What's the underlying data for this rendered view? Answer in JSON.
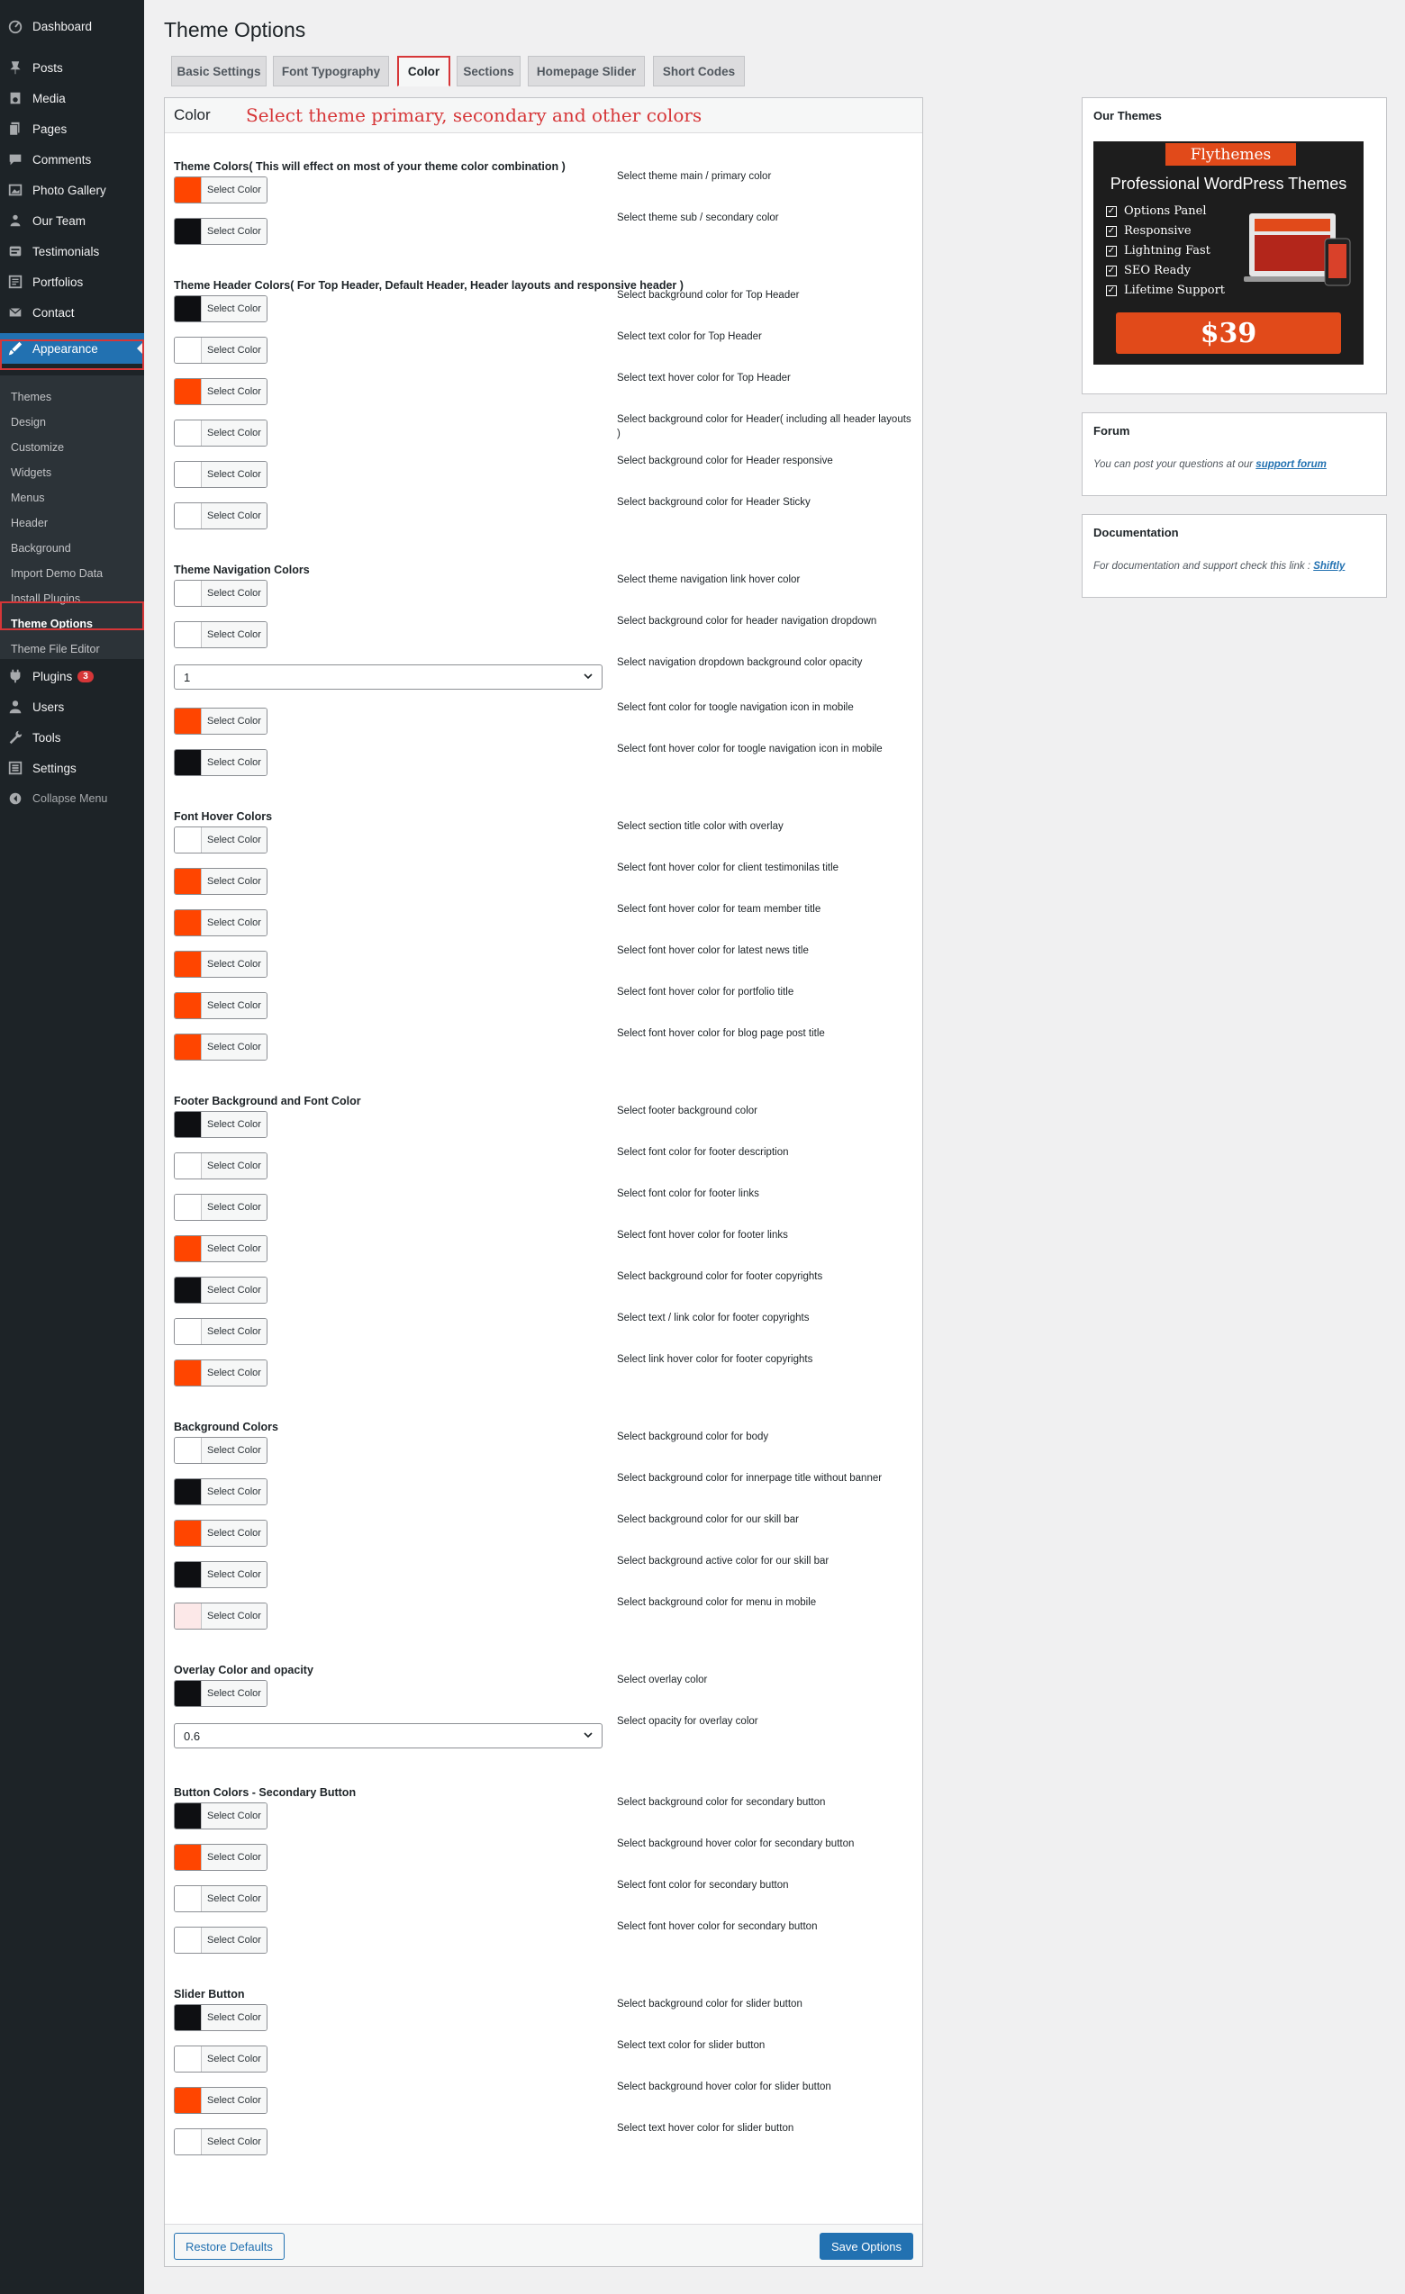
{
  "sidebar": {
    "items": [
      {
        "label": "Dashboard",
        "icon": "dashboard-icon"
      },
      {
        "label": "Posts",
        "icon": "pin-icon"
      },
      {
        "label": "Media",
        "icon": "media-icon"
      },
      {
        "label": "Pages",
        "icon": "pages-icon"
      },
      {
        "label": "Comments",
        "icon": "comments-icon"
      },
      {
        "label": "Photo Gallery",
        "icon": "gallery-icon"
      },
      {
        "label": "Our Team",
        "icon": "team-icon"
      },
      {
        "label": "Testimonials",
        "icon": "testimonials-icon"
      },
      {
        "label": "Portfolios",
        "icon": "portfolio-icon"
      },
      {
        "label": "Contact",
        "icon": "mail-icon"
      },
      {
        "label": "Appearance",
        "icon": "brush-icon"
      }
    ],
    "appearance_sub": [
      "Themes",
      "Design",
      "Customize",
      "Widgets",
      "Menus",
      "Header",
      "Background",
      "Import Demo Data",
      "Install Plugins",
      "Theme Options",
      "Theme File Editor"
    ],
    "lower_items": [
      {
        "label": "Plugins",
        "icon": "plugin-icon",
        "badge": "3"
      },
      {
        "label": "Users",
        "icon": "users-icon"
      },
      {
        "label": "Tools",
        "icon": "tools-icon"
      },
      {
        "label": "Settings",
        "icon": "settings-icon"
      },
      {
        "label": "Collapse Menu",
        "icon": "collapse-icon"
      }
    ]
  },
  "page_title": "Theme Options",
  "tabs": [
    "Basic Settings",
    "Font Typography",
    "Color",
    "Sections",
    "Homepage Slider",
    "Short Codes"
  ],
  "panel": {
    "title": "Color",
    "subtitle": "Select theme primary, secondary and other colors",
    "select_label": "Select Color",
    "sections": [
      {
        "title": "Theme Colors( This will effect on most of your theme color combination )",
        "rows": [
          {
            "type": "color",
            "desc": "Select theme main / primary color",
            "color": "#ff4500"
          },
          {
            "type": "color",
            "desc": "Select theme sub / secondary color",
            "color": "#0e0f12"
          }
        ]
      },
      {
        "title": "Theme Header Colors( For Top Header, Default Header, Header layouts and responsive header )",
        "rows": [
          {
            "type": "color",
            "desc": "Select background color for Top Header",
            "color": "#0e0f12"
          },
          {
            "type": "color",
            "desc": "Select text color for Top Header",
            "color": "#ffffff"
          },
          {
            "type": "color",
            "desc": "Select text hover color for Top Header",
            "color": "#ff4500"
          },
          {
            "type": "color",
            "desc": "Select background color for Header( including all header layouts )",
            "color": "#ffffff"
          },
          {
            "type": "color",
            "desc": "Select background color for Header responsive",
            "color": "#ffffff"
          },
          {
            "type": "color",
            "desc": "Select background color for Header Sticky",
            "color": "#ffffff"
          }
        ]
      },
      {
        "title": "Theme Navigation Colors",
        "rows": [
          {
            "type": "color",
            "desc": "Select theme navigation link hover color",
            "color": "#ffffff"
          },
          {
            "type": "color",
            "desc": "Select background color for header navigation dropdown",
            "color": "#ffffff"
          },
          {
            "type": "select",
            "desc": "Select navigation dropdown background color opacity",
            "value": "1"
          },
          {
            "type": "color",
            "desc": "Select font color for toogle navigation icon in mobile",
            "color": "#ff4500"
          },
          {
            "type": "color",
            "desc": "Select font hover color for toogle navigation icon in mobile",
            "color": "#0e0f12"
          }
        ]
      },
      {
        "title": "Font Hover Colors",
        "rows": [
          {
            "type": "color",
            "desc": "Select section title color with overlay",
            "color": "#ffffff"
          },
          {
            "type": "color",
            "desc": "Select font hover color for client testimonilas title",
            "color": "#ff4500"
          },
          {
            "type": "color",
            "desc": "Select font hover color for team member title",
            "color": "#ff4500"
          },
          {
            "type": "color",
            "desc": "Select font hover color for latest news title",
            "color": "#ff4500"
          },
          {
            "type": "color",
            "desc": "Select font hover color for portfolio title",
            "color": "#ff4500"
          },
          {
            "type": "color",
            "desc": "Select font hover color for blog page post title",
            "color": "#ff4500"
          }
        ]
      },
      {
        "title": "Footer Background and Font Color",
        "rows": [
          {
            "type": "color",
            "desc": "Select footer background color",
            "color": "#0e0f12"
          },
          {
            "type": "color",
            "desc": "Select font color for footer description",
            "color": "#ffffff"
          },
          {
            "type": "color",
            "desc": "Select font color for footer links",
            "color": "#ffffff"
          },
          {
            "type": "color",
            "desc": "Select font hover color for footer links",
            "color": "#ff4500"
          },
          {
            "type": "color",
            "desc": "Select background color for footer copyrights",
            "color": "#0e0f12"
          },
          {
            "type": "color",
            "desc": "Select text / link color for footer copyrights",
            "color": "#ffffff"
          },
          {
            "type": "color",
            "desc": "Select link hover color for footer copyrights",
            "color": "#ff4500"
          }
        ]
      },
      {
        "title": "Background Colors",
        "rows": [
          {
            "type": "color",
            "desc": "Select background color for body",
            "color": "#ffffff"
          },
          {
            "type": "color",
            "desc": "Select background color for innerpage title without banner",
            "color": "#0e0f12"
          },
          {
            "type": "color",
            "desc": "Select background color for our skill bar",
            "color": "#ff4500"
          },
          {
            "type": "color",
            "desc": "Select background active color for our skill bar",
            "color": "#0e0f12"
          },
          {
            "type": "color",
            "desc": "Select background color for menu in mobile",
            "color": "#fce8e8"
          }
        ]
      },
      {
        "title": "Overlay Color and opacity",
        "rows": [
          {
            "type": "color",
            "desc": "Select overlay color",
            "color": "#0e0f12"
          },
          {
            "type": "select",
            "desc": "Select opacity for overlay color",
            "value": "0.6"
          }
        ]
      },
      {
        "title": "Button Colors - Secondary Button",
        "rows": [
          {
            "type": "color",
            "desc": "Select background color for secondary button",
            "color": "#0e0f12"
          },
          {
            "type": "color",
            "desc": "Select background hover color for secondary button",
            "color": "#ff4500"
          },
          {
            "type": "color",
            "desc": "Select font color for secondary button",
            "color": "#ffffff"
          },
          {
            "type": "color",
            "desc": "Select font hover color for secondary button",
            "color": "#ffffff"
          }
        ]
      },
      {
        "title": "Slider Button",
        "rows": [
          {
            "type": "color",
            "desc": "Select background color for slider button",
            "color": "#0e0f12"
          },
          {
            "type": "color",
            "desc": "Select text color for slider button",
            "color": "#ffffff"
          },
          {
            "type": "color",
            "desc": "Select background hover color for slider button",
            "color": "#ff4500"
          },
          {
            "type": "color",
            "desc": "Select text hover color for slider button",
            "color": "#ffffff"
          }
        ]
      }
    ],
    "restore_label": "Restore Defaults",
    "save_label": "Save Options"
  },
  "side": {
    "themes_title": "Our Themes",
    "promo": {
      "brand": "Flythemes",
      "heading": "Professional WordPress Themes",
      "features": [
        "Options Panel",
        "Responsive",
        "Lightning Fast",
        "SEO Ready",
        "Lifetime Support"
      ],
      "price": "$39"
    },
    "forum_title": "Forum",
    "forum_text": "You can post your questions at our",
    "forum_link": "support forum",
    "doc_title": "Documentation",
    "doc_text": "For documentation and support check this link :",
    "doc_link": "Shiftly"
  },
  "colors": {
    "accent": "#2271b1",
    "brand_red": "#ff4500",
    "dark": "#0e0f12",
    "highlight": "#d63638"
  }
}
